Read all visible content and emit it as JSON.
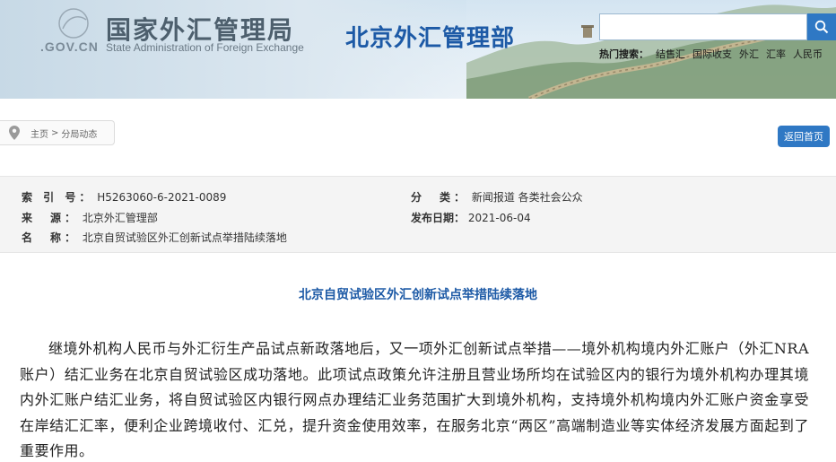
{
  "header": {
    "org_name_cn": "国家外汇管理局",
    "org_domain": ".GOV.CN",
    "org_name_en": "State Administration of Foreign Exchange",
    "dept_title": "北京外汇管理部",
    "search": {
      "placeholder": ""
    },
    "hot_search": {
      "label": "热门搜索：",
      "links": [
        "结售汇",
        "国际收支",
        "外汇",
        "汇率",
        "人民币"
      ]
    }
  },
  "breadcrumb": {
    "home": "主页",
    "separator": ">",
    "current": "分局动态"
  },
  "back_button": "返回首页",
  "meta": {
    "index_label": "索 引 号：",
    "index_value": "H5263060-6-2021-0089",
    "category_label": "分　类：",
    "category_value": "新闻报道  各类社会公众",
    "source_label": "来　源：",
    "source_value": "北京外汇管理部",
    "date_label": "发布日期：",
    "date_value": "2021-06-04",
    "name_label": "名　称：",
    "name_value": "北京自贸试验区外汇创新试点举措陆续落地"
  },
  "article": {
    "title": "北京自贸试验区外汇创新试点举措陆续落地",
    "paragraph": "继境外机构人民币与外汇衍生产品试点新政落地后，又一项外汇创新试点举措——境外机构境内外汇账户（外汇NRA账户）结汇业务在北京自贸试验区成功落地。此项试点政策允许注册且营业场所均在试验区内的银行为境外机构办理其境内外汇账户结汇业务，将自贸试验区内银行网点办理结汇业务范围扩大到境外机构，支持境外机构境内外汇账户资金享受在岸结汇汇率，便利企业跨境收付、汇兑，提升资金使用效率，在服务北京“两区”高端制造业等实体经济发展方面起到了重要作用。"
  },
  "colors": {
    "accent_blue": "#2f78c4",
    "title_blue": "#1d5aa6",
    "meta_bg": "#f4f4f4"
  }
}
